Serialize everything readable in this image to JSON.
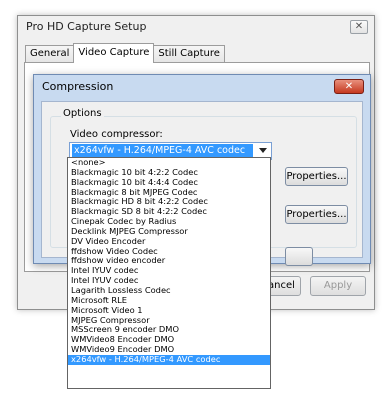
{
  "outer_window": {
    "title": "Pro HD Capture Setup",
    "close_glyph": "✕",
    "tabs": [
      {
        "label": "General",
        "active": false
      },
      {
        "label": "Video Capture",
        "active": true
      },
      {
        "label": "Still Capture",
        "active": false
      }
    ],
    "cancel_label": "Cancel",
    "apply_label": "Apply"
  },
  "dialog": {
    "title": "Compression",
    "close_glyph": "✕",
    "options_group_label": "Options",
    "video_compressor_label": "Video compressor:",
    "selected_compressor": "x264vfw - H.264/MPEG-4 AVC codec",
    "properties_label_1": "Properties...",
    "properties_label_2": "Properties...",
    "compressor_options": [
      "<none>",
      "Blackmagic 10 bit 4:2:2 Codec",
      "Blackmagic 10 bit 4:4:4 Codec",
      "Blackmagic 8 bit MJPEG Codec",
      "Blackmagic HD 8 bit 4:2:2 Codec",
      "Blackmagic SD 8 bit 4:2:2 Codec",
      "Cinepak Codec by Radius",
      "Decklink MJPEG Compressor",
      "DV Video Encoder",
      "ffdshow Video Codec",
      "ffdshow video encoder",
      "Intel IYUV codec",
      "Intel IYUV codec",
      "Lagarith Lossless Codec",
      "Microsoft RLE",
      "Microsoft Video 1",
      "MJPEG Compressor",
      "MSScreen 9 encoder DMO",
      "WMVideo8 Encoder DMO",
      "WMVideo9 Encoder DMO",
      "x264vfw - H.264/MPEG-4 AVC codec"
    ],
    "selected_index": 20
  },
  "colors": {
    "selection": "#3399ff",
    "dialog_frame": "#c8daf0",
    "close_button_red": "#c5381f"
  }
}
